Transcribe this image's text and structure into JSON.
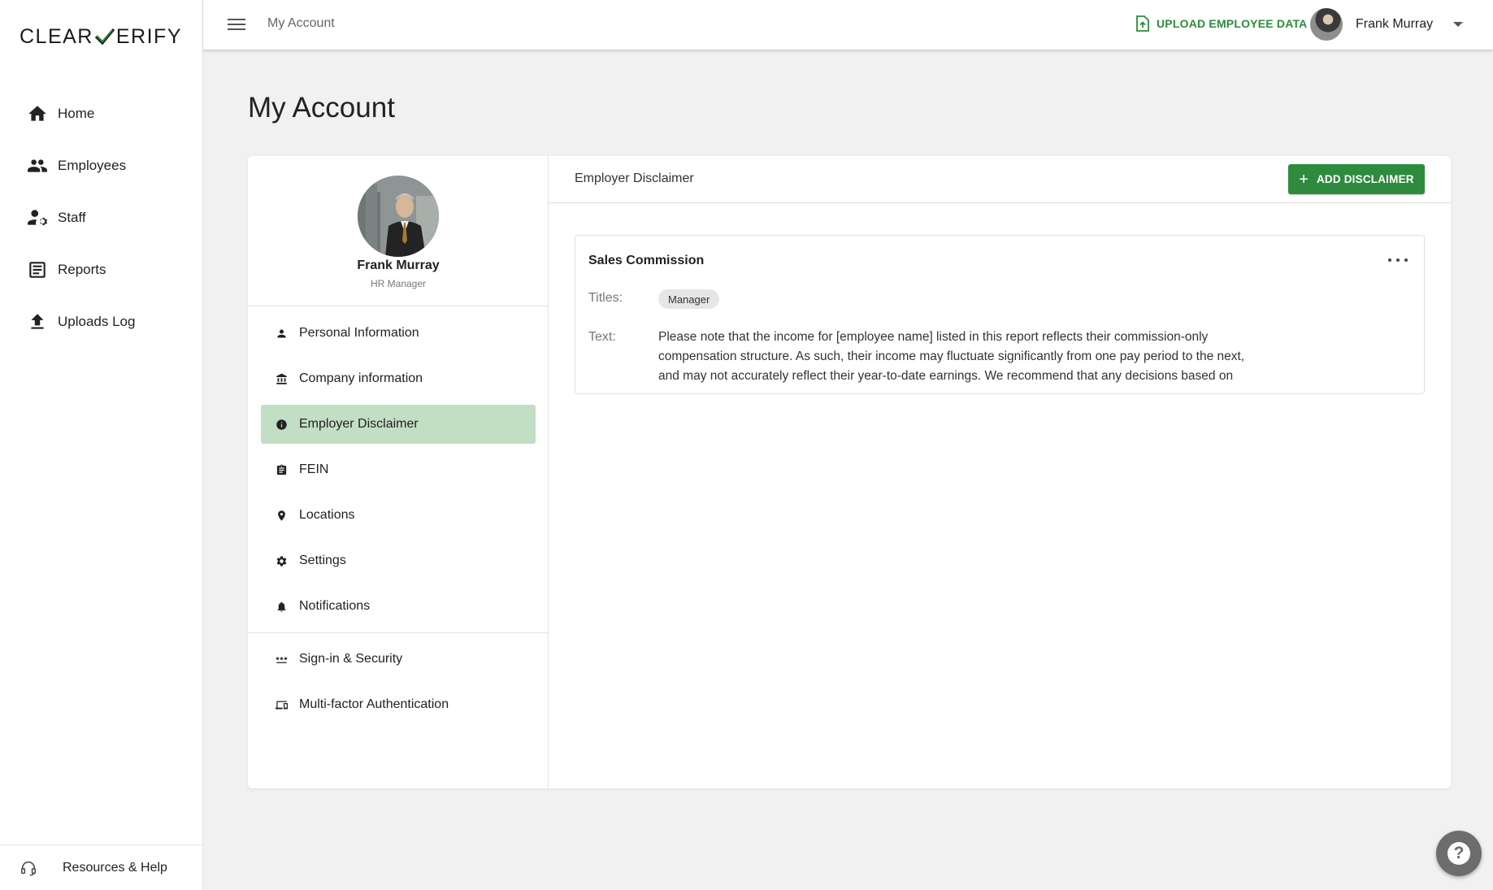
{
  "brand": {
    "logo_left": "CLEAR",
    "logo_right": "ERIFY",
    "accent": "#2e8b3e"
  },
  "sidebar": {
    "items": [
      {
        "label": "Home",
        "icon": "home-icon"
      },
      {
        "label": "Employees",
        "icon": "people-icon"
      },
      {
        "label": "Staff",
        "icon": "staff-settings-icon"
      },
      {
        "label": "Reports",
        "icon": "reports-icon"
      },
      {
        "label": "Uploads Log",
        "icon": "upload-icon"
      }
    ],
    "footer_label": "Resources & Help"
  },
  "topbar": {
    "breadcrumb": "My Account",
    "upload_label": "UPLOAD EMPLOYEE DATA",
    "user_name": "Frank Murray"
  },
  "page": {
    "title": "My Account"
  },
  "profile": {
    "name": "Frank Murray",
    "role": "HR Manager"
  },
  "menu": {
    "items": [
      {
        "label": "Personal Information",
        "icon": "person-icon"
      },
      {
        "label": "Company information",
        "icon": "bank-icon"
      },
      {
        "label": "Employer Disclaimer",
        "icon": "info-icon",
        "active": true
      },
      {
        "label": "FEIN",
        "icon": "clipboard-icon"
      },
      {
        "label": "Locations",
        "icon": "location-pin-icon"
      },
      {
        "label": "Settings",
        "icon": "gear-icon"
      },
      {
        "label": "Notifications",
        "icon": "bell-icon"
      }
    ],
    "security_items": [
      {
        "label": "Sign-in & Security",
        "icon": "password-dots-icon"
      },
      {
        "label": "Multi-factor Authentication",
        "icon": "devices-icon"
      }
    ]
  },
  "panel": {
    "title": "Employer Disclaimer",
    "add_button": "ADD DISCLAIMER",
    "disclaimer": {
      "name": "Sales Commission",
      "titles_label": "Titles:",
      "titles": [
        "Manager"
      ],
      "text_label": "Text:",
      "text": "Please note that the income for [employee name] listed in this report reflects their commission-only compensation structure. As such, their income may fluctuate significantly from one pay period to the next, and may not accurately reflect their year-to-date earnings. We recommend that any decisions based on"
    }
  }
}
